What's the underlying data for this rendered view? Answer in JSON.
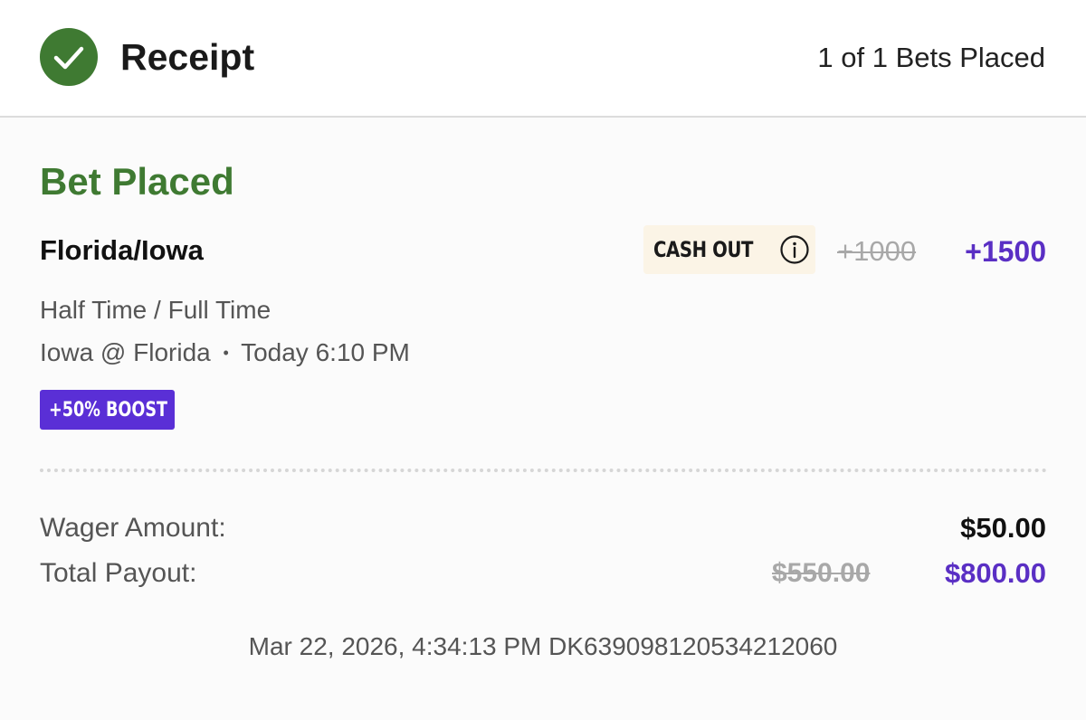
{
  "header": {
    "title": "Receipt",
    "bets_count": "1 of 1 Bets Placed",
    "status_icon": "check-circle-icon"
  },
  "bet": {
    "status": "Bet Placed",
    "event": "Florida/Iowa",
    "cash_out_label": "CASH OUT",
    "info_icon": "info-icon",
    "original_odds": "+1000",
    "boosted_odds": "+1500",
    "market": "Half Time / Full Time",
    "matchup": "Iowa @ Florida",
    "separator": "•",
    "start_time": "Today 6:10 PM",
    "boost_badge": "+50% BOOST"
  },
  "summary": {
    "wager_label": "Wager Amount:",
    "wager_value": "$50.00",
    "payout_label": "Total Payout:",
    "payout_original": "$550.00",
    "payout_boosted": "$800.00"
  },
  "footer": {
    "timestamp": "Mar 22, 2026, 4:34:13 PM",
    "bet_id": "DK639098120534212060"
  },
  "colors": {
    "success_green": "#3f7a32",
    "boost_purple": "#5a2fc4",
    "badge_purple": "#5a2fd6",
    "cash_out_bg": "#fbf4e6",
    "strikethrough_gray": "#a8a8a8"
  }
}
